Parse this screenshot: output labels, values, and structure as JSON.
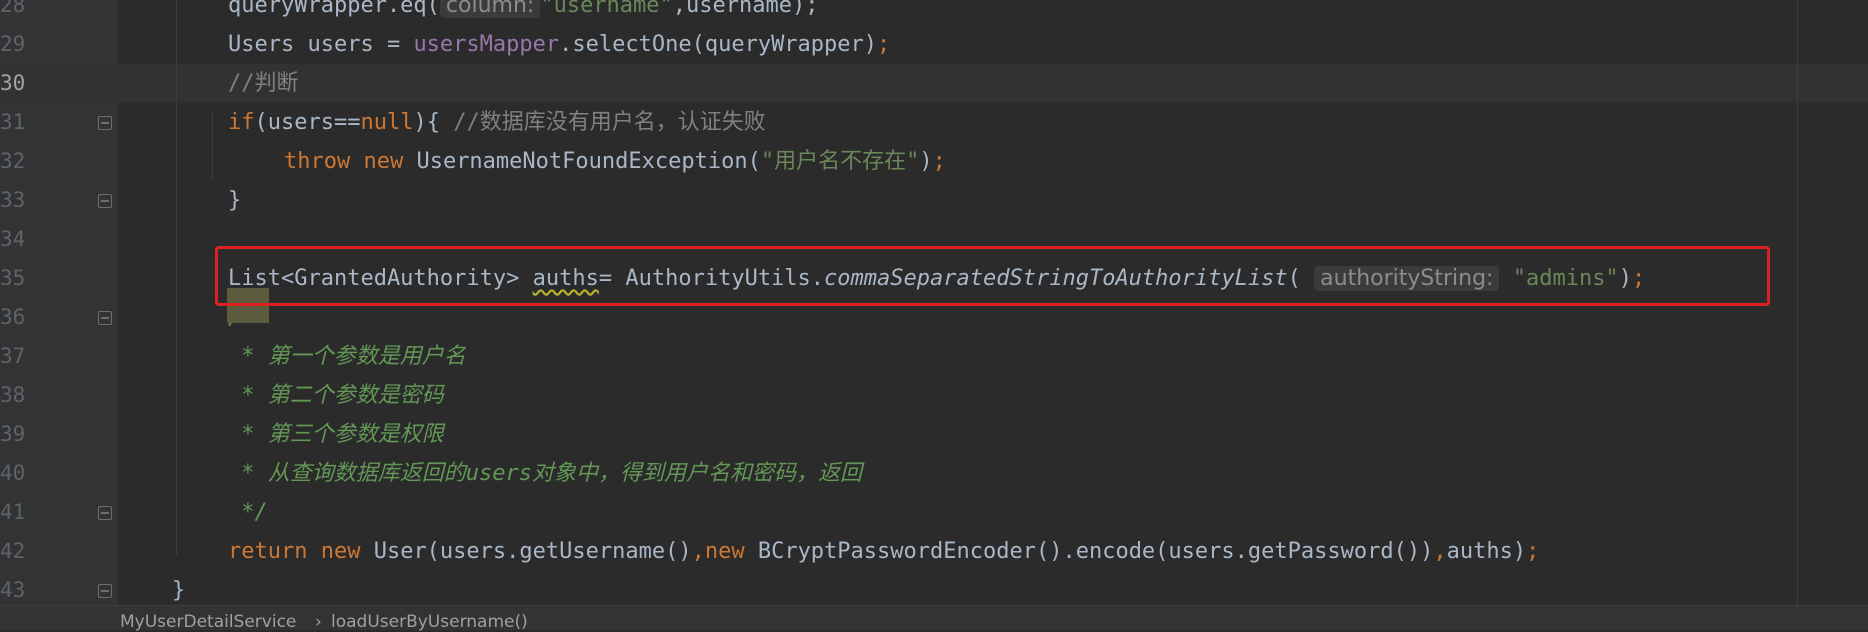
{
  "editor": {
    "lines": [
      {
        "num": "28",
        "segments": [
          {
            "t": "queryWrapper.eq(",
            "c": "plain"
          },
          {
            "t": "column:",
            "c": "hint"
          },
          {
            "t": "\"username\"",
            "c": "str"
          },
          {
            "t": ",username);",
            "c": "plain"
          }
        ]
      },
      {
        "num": "29",
        "segments": [
          {
            "t": "Users users = ",
            "c": "plain"
          },
          {
            "t": "usersMapper",
            "c": "field"
          },
          {
            "t": ".selectOne(queryWrapper)",
            "c": "plain"
          },
          {
            "t": ";",
            "c": "kw"
          }
        ]
      },
      {
        "num": "30",
        "segments": [
          {
            "t": "//判断",
            "c": "cm"
          }
        ]
      },
      {
        "num": "31",
        "segments": [
          {
            "t": "if",
            "c": "kw"
          },
          {
            "t": "(users==",
            "c": "plain"
          },
          {
            "t": "null",
            "c": "kw"
          },
          {
            "t": "){ ",
            "c": "plain"
          },
          {
            "t": "//数据库没有用户名，认证失败",
            "c": "cm"
          }
        ]
      },
      {
        "num": "32",
        "segments": [
          {
            "t": "throw new ",
            "c": "kw"
          },
          {
            "t": "UsernameNotFoundException(",
            "c": "plain"
          },
          {
            "t": "\"用户名不存在\"",
            "c": "str"
          },
          {
            "t": ")",
            "c": "plain"
          },
          {
            "t": ";",
            "c": "kw"
          }
        ]
      },
      {
        "num": "33",
        "segments": [
          {
            "t": "}",
            "c": "plain"
          }
        ]
      },
      {
        "num": "34",
        "segments": []
      },
      {
        "num": "35",
        "segments": [
          {
            "t": "List<GrantedAuthority> ",
            "c": "plain"
          },
          {
            "t": "auths",
            "c": "squiggle"
          },
          {
            "t": "= AuthorityUtils.",
            "c": "plain"
          },
          {
            "t": "commaSeparatedStringToAuthorityList",
            "c": "method-static"
          },
          {
            "t": "( ",
            "c": "plain"
          },
          {
            "t": "authorityString:",
            "c": "hint"
          },
          {
            "t": " ",
            "c": "plain"
          },
          {
            "t": "\"admins\"",
            "c": "str"
          },
          {
            "t": ")",
            "c": "plain"
          },
          {
            "t": ";",
            "c": "kw"
          }
        ]
      },
      {
        "num": "36",
        "segments": [
          {
            "t": "/**",
            "c": "doc"
          }
        ]
      },
      {
        "num": "37",
        "segments": [
          {
            "t": " * 第一个参数是用户名",
            "c": "doc"
          }
        ]
      },
      {
        "num": "38",
        "segments": [
          {
            "t": " * 第二个参数是密码",
            "c": "doc"
          }
        ]
      },
      {
        "num": "39",
        "segments": [
          {
            "t": " * 第三个参数是权限",
            "c": "doc"
          }
        ]
      },
      {
        "num": "40",
        "segments": [
          {
            "t": " * 从查询数据库返回的users对象中，得到用户名和密码，返回",
            "c": "doc"
          }
        ]
      },
      {
        "num": "41",
        "segments": [
          {
            "t": " */",
            "c": "doc"
          }
        ]
      },
      {
        "num": "42",
        "segments": [
          {
            "t": "return new ",
            "c": "kw"
          },
          {
            "t": "User(users.getUsername()",
            "c": "plain"
          },
          {
            "t": ",",
            "c": "kw"
          },
          {
            "t": "new ",
            "c": "kw"
          },
          {
            "t": "BCryptPasswordEncoder().encode(users.getPassword())",
            "c": "plain"
          },
          {
            "t": ",",
            "c": "kw"
          },
          {
            "t": "auths)",
            "c": "plain"
          },
          {
            "t": ";",
            "c": "kw"
          }
        ]
      },
      {
        "num": "43",
        "segments": [
          {
            "t": "}",
            "c": "plain"
          }
        ]
      }
    ],
    "current_line": "30"
  },
  "breadcrumb": {
    "class_name": "MyUserDetailService",
    "separator": "›",
    "method_name": "loadUserByUsername()"
  },
  "colors": {
    "background": "#2b2b2b",
    "gutter": "#313335",
    "keyword": "#cc7832",
    "string": "#6a8759",
    "field": "#9876aa",
    "comment": "#808080",
    "doc_comment": "#629755",
    "highlight_box": "#e02020"
  }
}
